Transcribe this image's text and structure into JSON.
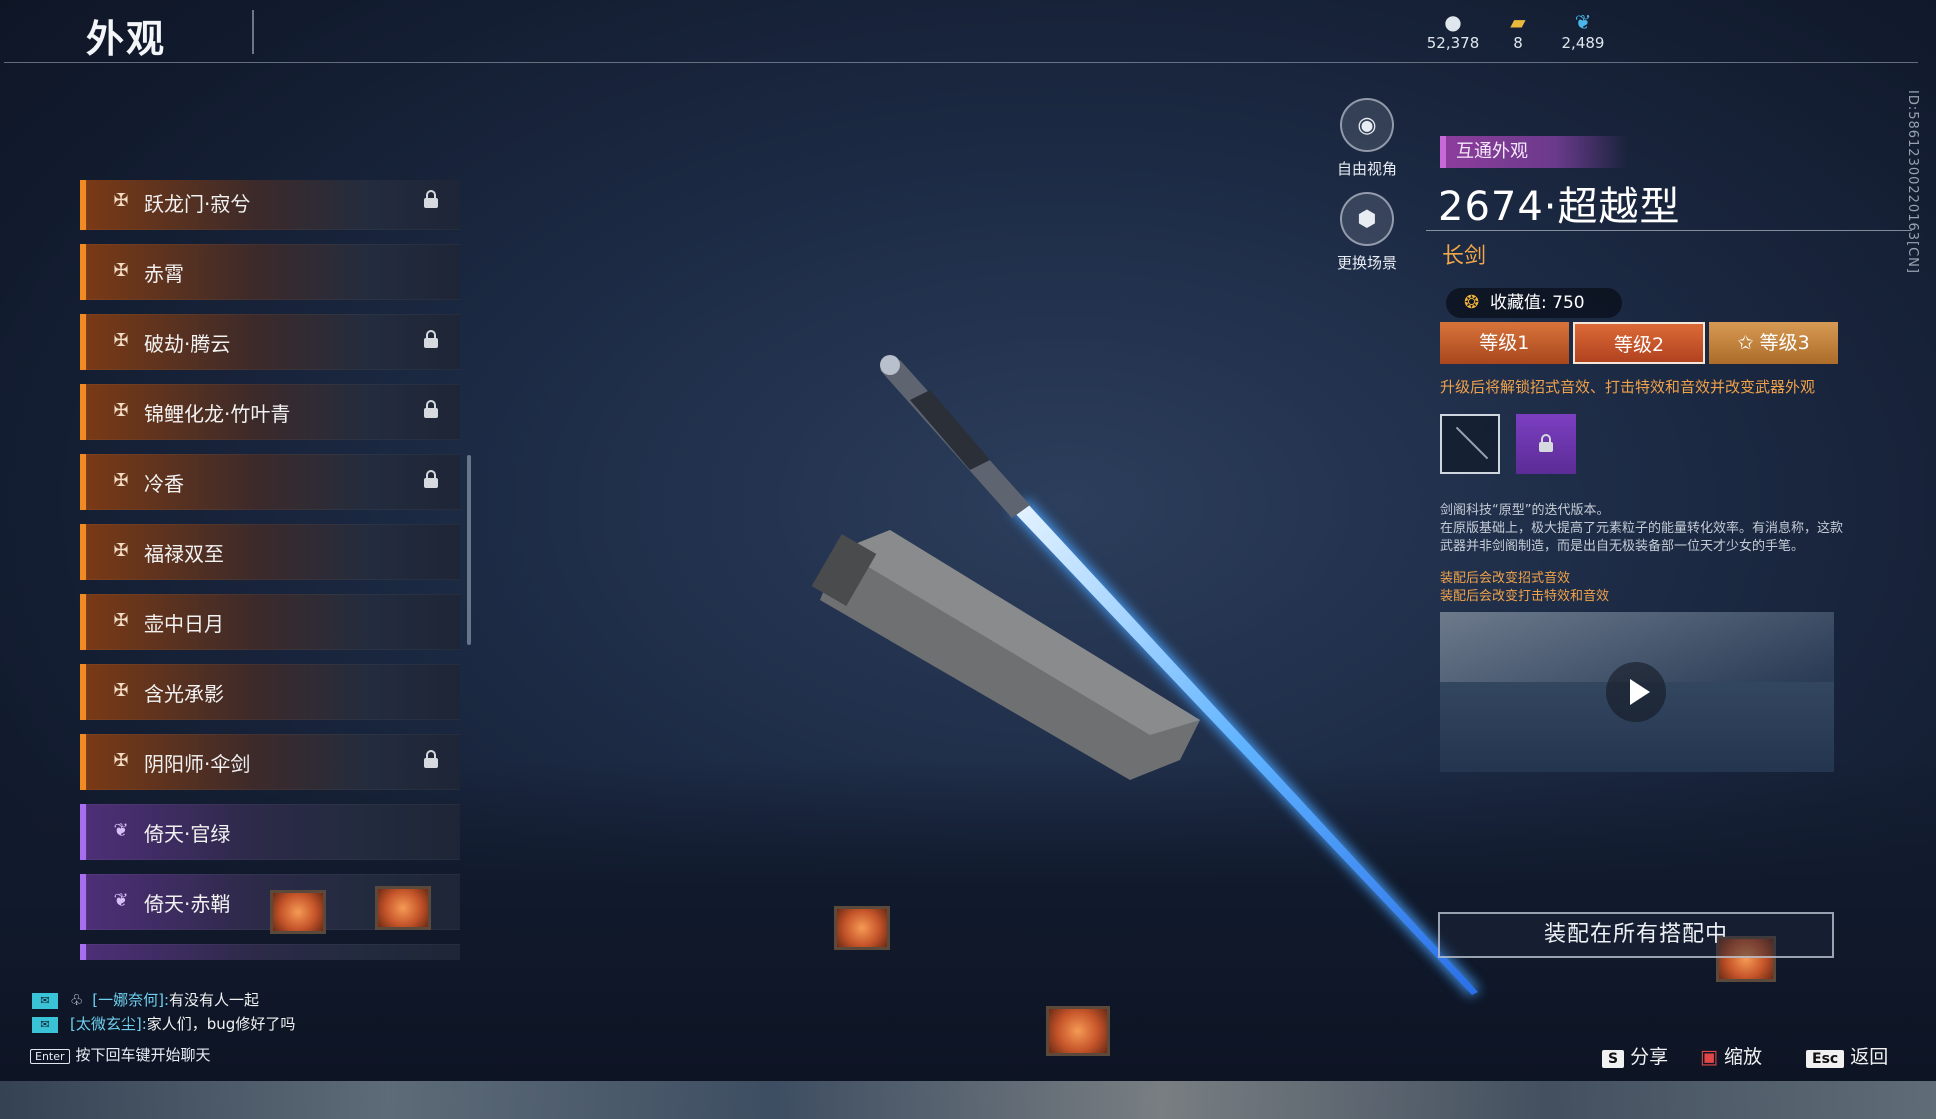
{
  "header": {
    "title": "外观"
  },
  "currencies": [
    {
      "icon": "coin-icon",
      "value": "52,378"
    },
    {
      "icon": "ticket-icon",
      "value": "8"
    },
    {
      "icon": "feather-icon",
      "value": "2,489"
    }
  ],
  "list": {
    "items": [
      {
        "label": "跃龙门·寂兮",
        "rarity": "orange",
        "locked": true
      },
      {
        "label": "赤霄",
        "rarity": "orange",
        "locked": false
      },
      {
        "label": "破劫·腾云",
        "rarity": "orange",
        "locked": true
      },
      {
        "label": "锦鲤化龙·竹叶青",
        "rarity": "orange",
        "locked": true
      },
      {
        "label": "冷香",
        "rarity": "orange",
        "locked": true
      },
      {
        "label": "福禄双至",
        "rarity": "orange",
        "locked": false
      },
      {
        "label": "壶中日月",
        "rarity": "orange",
        "locked": false
      },
      {
        "label": "含光承影",
        "rarity": "orange",
        "locked": false
      },
      {
        "label": "阴阳师·伞剑",
        "rarity": "orange",
        "locked": true
      },
      {
        "label": "倚天·官绿",
        "rarity": "purple",
        "locked": false
      },
      {
        "label": "倚天·赤鞘",
        "rarity": "purple",
        "locked": false
      },
      {
        "label": "",
        "rarity": "purple",
        "locked": false
      }
    ]
  },
  "side_buttons": {
    "free_view": "自由视角",
    "change_scene": "更换场景"
  },
  "detail": {
    "badge": "互通外观",
    "name": "2674·超越型",
    "type": "长剑",
    "collection_label": "收藏值: 750",
    "levels": [
      "等级1",
      "等级2",
      "等级3"
    ],
    "selected_level": 1,
    "upgrade_tip": "升级后将解锁招式音效、打击特效和音效并改变武器外观",
    "description_1": "剑阁科技“原型”的迭代版本。",
    "description_2": "在原版基础上，极大提高了元素粒子的能量转化效率。有消息称，这款武器并非剑阁制造，而是出自无极装备部一位天才少女的手笔。",
    "effect_1": "装配后会改变招式音效",
    "effect_2": "装配后会改变打击特效和音效",
    "equip_button": "装配在所有搭配中",
    "vertical_id": "ID:5861230022016​3[CN]"
  },
  "chat": {
    "lines": [
      {
        "name": "[一娜奈何]:",
        "msg": "有没有人一起"
      },
      {
        "name": "[太微玄尘]:",
        "msg": "家人们，bug修好了吗"
      }
    ],
    "enter_key": "Enter",
    "hint": "按下回车键开始聊天"
  },
  "footer_keys": {
    "share_key": "S",
    "share": "分享",
    "zoom": "缩放",
    "back_key": "Esc",
    "back": "返回"
  },
  "colors": {
    "orange_rarity": "#f18a23",
    "purple_rarity": "#a86ef0",
    "accent_text": "#f0a24a"
  }
}
